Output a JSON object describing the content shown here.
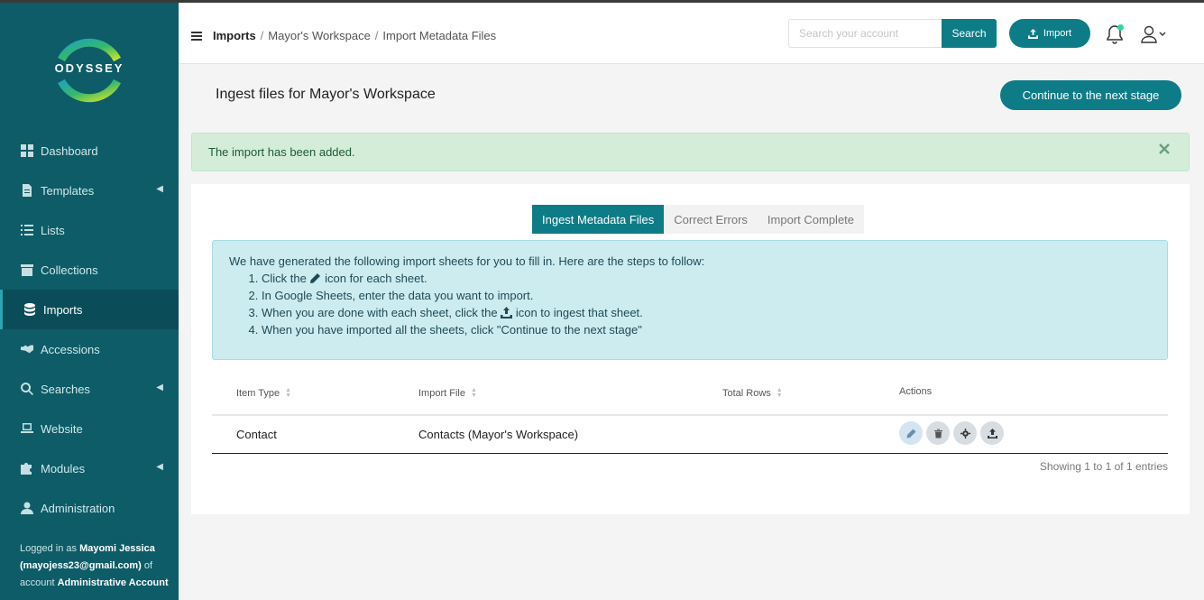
{
  "app": {
    "logo_text": "ODYSSEY"
  },
  "sidebar": {
    "items": [
      {
        "label": "Dashboard",
        "icon": "dashboard-icon"
      },
      {
        "label": "Templates",
        "icon": "file-icon"
      },
      {
        "label": "Lists",
        "icon": "list-icon"
      },
      {
        "label": "Collections",
        "icon": "archive-icon"
      },
      {
        "label": "Imports",
        "icon": "database-icon"
      },
      {
        "label": "Accessions",
        "icon": "handshake-icon"
      },
      {
        "label": "Searches",
        "icon": "search-icon"
      },
      {
        "label": "Website",
        "icon": "laptop-icon"
      },
      {
        "label": "Modules",
        "icon": "puzzle-icon"
      },
      {
        "label": "Administration",
        "icon": "user-icon"
      }
    ],
    "active_item": "Imports",
    "logged_in": {
      "prefix": "Logged in as",
      "name": "Mayomi Jessica",
      "email": "(mayojess23@gmail.com)",
      "of_account": "of account",
      "account": "Administrative Account"
    }
  },
  "header": {
    "breadcrumb": [
      "Imports",
      "Mayor's Workspace",
      "Import Metadata Files"
    ],
    "search_placeholder": "Search your account",
    "search_button": "Search",
    "import_button": "Import"
  },
  "page": {
    "title": "Ingest files for Mayor's Workspace",
    "continue_button": "Continue to the next stage",
    "alert": "The import has been added."
  },
  "tabs": [
    "Ingest Metadata Files",
    "Correct Errors",
    "Import Complete"
  ],
  "active_tab": "Ingest Metadata Files",
  "info": {
    "intro": "We have generated the following import sheets for you to fill in. Here are the steps to follow:",
    "step1_a": "Click the",
    "step1_b": "icon for each sheet.",
    "step2": "In Google Sheets, enter the data you want to import.",
    "step3_a": "When you are done with each sheet, click the",
    "step3_b": "icon to ingest that sheet.",
    "step4": "When you have imported all the sheets, click \"Continue to the next stage\""
  },
  "table": {
    "columns": [
      "Item Type",
      "Import File",
      "Total Rows",
      "Actions"
    ],
    "rows": [
      {
        "item_type": "Contact",
        "import_file": "Contacts (Mayor's Workspace)",
        "total_rows": ""
      }
    ],
    "footer": "Showing 1 to 1 of 1 entries"
  },
  "colors": {
    "sidebar_bg": "#0d5c68",
    "accent": "#0d7c87",
    "alert_bg": "#d4edd9",
    "info_bg": "#cdecf0"
  }
}
